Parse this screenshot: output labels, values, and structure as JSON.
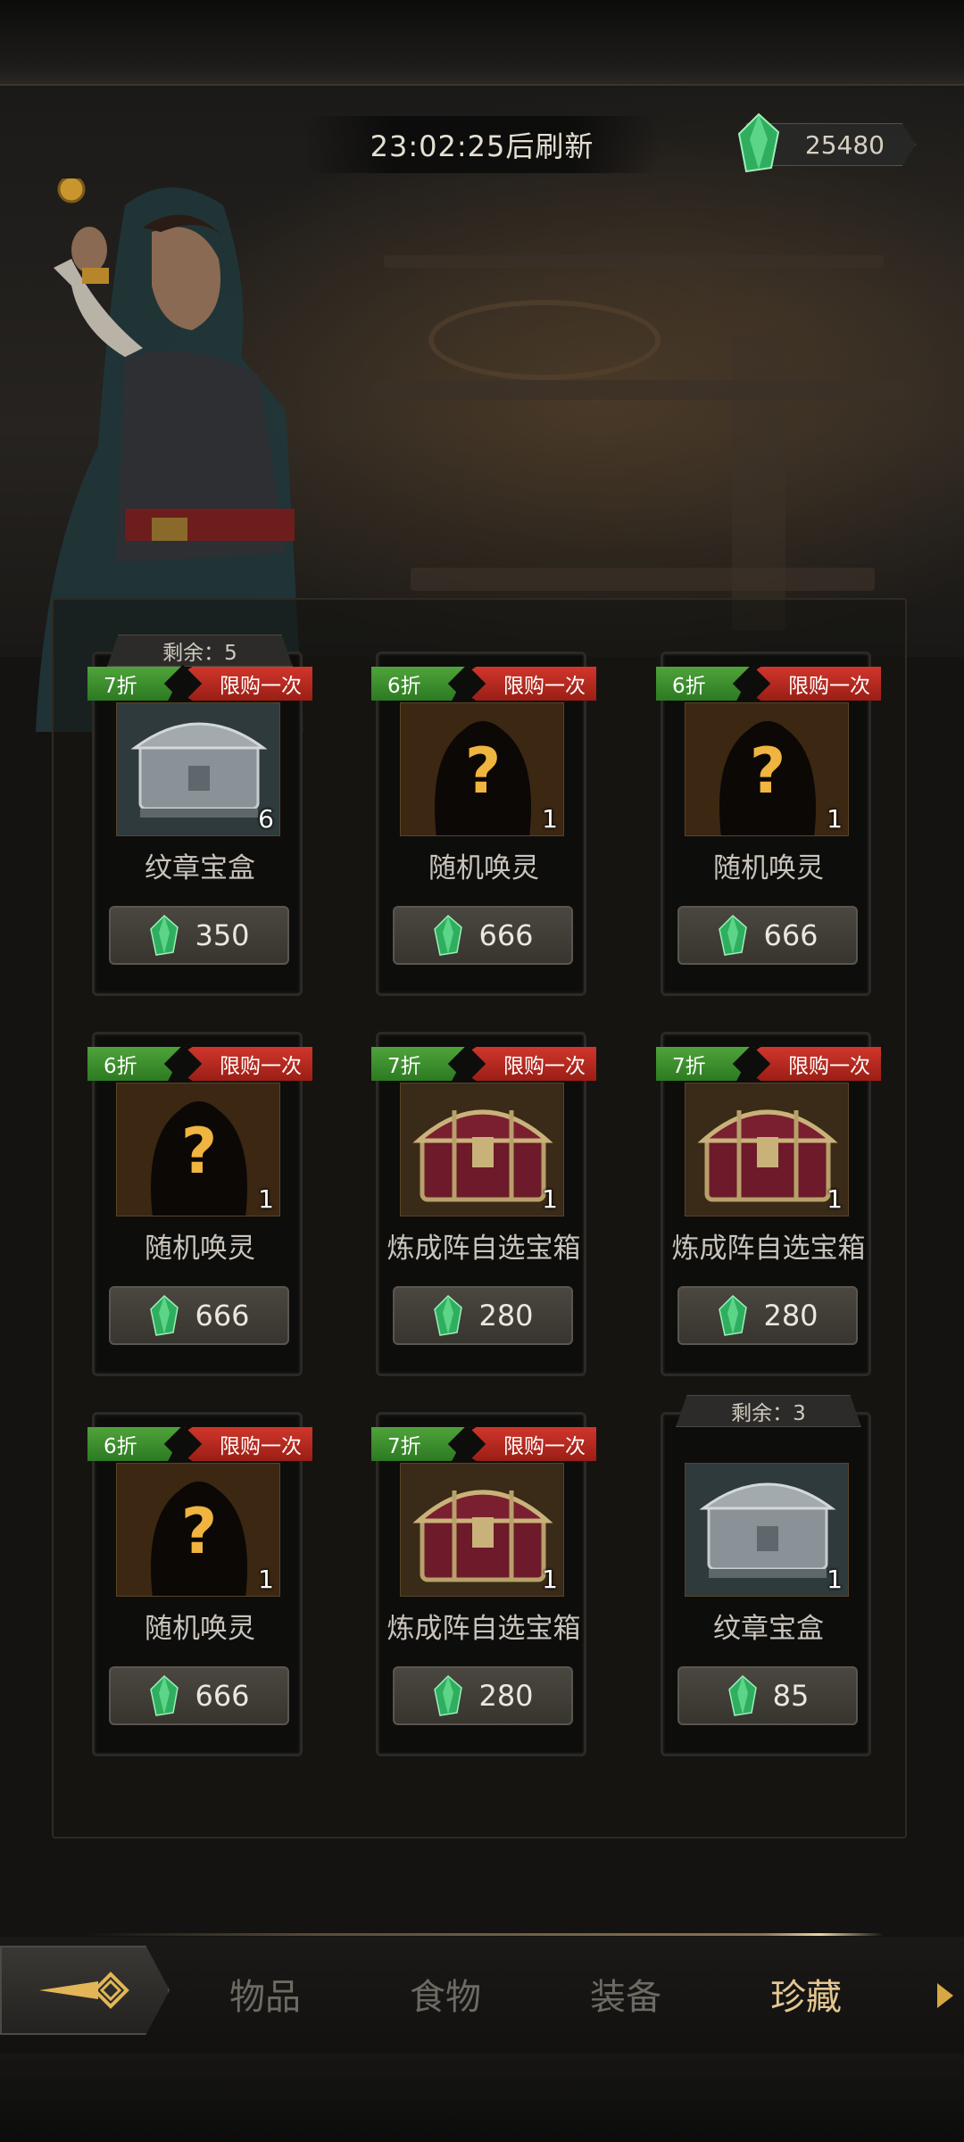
{
  "header": {
    "refresh_timer": "23:02:25后刷新",
    "currency_amount": "25480",
    "currency_icon": "green-crystal-icon"
  },
  "shop": {
    "items": [
      {
        "remaining": "剩余：5",
        "discount": "7折",
        "limit": "限购一次",
        "image": "emblem-chest",
        "count": "6",
        "name": "纹章宝盒",
        "price": "350"
      },
      {
        "remaining": "",
        "discount": "6折",
        "limit": "限购一次",
        "image": "mystery-silhouette",
        "count": "1",
        "name": "随机唤灵",
        "price": "666"
      },
      {
        "remaining": "",
        "discount": "6折",
        "limit": "限购一次",
        "image": "mystery-silhouette",
        "count": "1",
        "name": "随机唤灵",
        "price": "666"
      },
      {
        "remaining": "",
        "discount": "6折",
        "limit": "限购一次",
        "image": "mystery-silhouette",
        "count": "1",
        "name": "随机唤灵",
        "price": "666"
      },
      {
        "remaining": "",
        "discount": "7折",
        "limit": "限购一次",
        "image": "treasure-chest",
        "count": "1",
        "name": "炼成阵自选宝箱",
        "price": "280"
      },
      {
        "remaining": "",
        "discount": "7折",
        "limit": "限购一次",
        "image": "treasure-chest",
        "count": "1",
        "name": "炼成阵自选宝箱",
        "price": "280"
      },
      {
        "remaining": "",
        "discount": "6折",
        "limit": "限购一次",
        "image": "mystery-silhouette",
        "count": "1",
        "name": "随机唤灵",
        "price": "666"
      },
      {
        "remaining": "",
        "discount": "7折",
        "limit": "限购一次",
        "image": "treasure-chest",
        "count": "1",
        "name": "炼成阵自选宝箱",
        "price": "280"
      },
      {
        "remaining": "剩余：3",
        "discount": "",
        "limit": "",
        "image": "emblem-chest",
        "count": "1",
        "name": "纹章宝盒",
        "price": "85"
      }
    ]
  },
  "nav": {
    "tabs": [
      "物品",
      "食物",
      "装备",
      "珍藏"
    ],
    "active_tab": "珍藏"
  },
  "colors": {
    "discount_tag": "#3f9330",
    "limit_tag": "#c12c22",
    "active_tab": "#e4c690",
    "gem": "#3fd07a"
  }
}
